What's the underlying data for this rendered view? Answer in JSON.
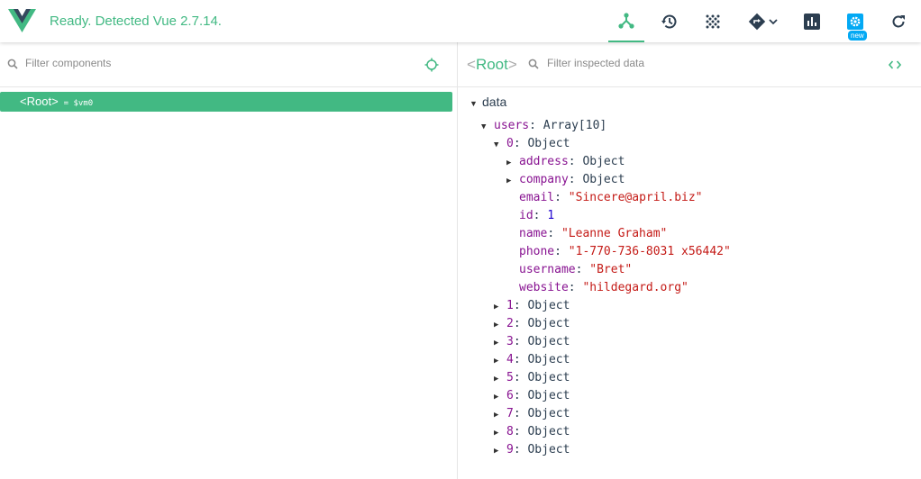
{
  "header": {
    "status": "Ready. Detected Vue 2.7.14.",
    "new_badge": "new",
    "accent": "#42b983"
  },
  "toolbar": [
    "components-icon",
    "history-icon",
    "vuex-dots-icon",
    "routing-icon",
    "chart-icon",
    "settings-icon",
    "refresh-icon"
  ],
  "left": {
    "search_placeholder": "Filter components",
    "root_open": "<",
    "root_name": "Root",
    "root_close": ">",
    "vm_label": "= $vm0"
  },
  "right": {
    "root_open": "<",
    "root_name": "Root",
    "root_close": ">",
    "search_placeholder": "Filter inspected data",
    "section": "data"
  },
  "tree": {
    "users_key": "users",
    "users_type": "Array[10]",
    "item0_key": "0",
    "item0_type": "Object",
    "fields": [
      {
        "key": "address",
        "value": "Object",
        "kind": "obj"
      },
      {
        "key": "company",
        "value": "Object",
        "kind": "obj"
      },
      {
        "key": "email",
        "value": "\"Sincere@april.biz\"",
        "kind": "str"
      },
      {
        "key": "id",
        "value": "1",
        "kind": "num"
      },
      {
        "key": "name",
        "value": "\"Leanne Graham\"",
        "kind": "str"
      },
      {
        "key": "phone",
        "value": "\"1-770-736-8031 x56442\"",
        "kind": "str"
      },
      {
        "key": "username",
        "value": "\"Bret\"",
        "kind": "str"
      },
      {
        "key": "website",
        "value": "\"hildegard.org\"",
        "kind": "str"
      }
    ],
    "collapsed": [
      {
        "key": "1",
        "value": "Object"
      },
      {
        "key": "2",
        "value": "Object"
      },
      {
        "key": "3",
        "value": "Object"
      },
      {
        "key": "4",
        "value": "Object"
      },
      {
        "key": "5",
        "value": "Object"
      },
      {
        "key": "6",
        "value": "Object"
      },
      {
        "key": "7",
        "value": "Object"
      },
      {
        "key": "8",
        "value": "Object"
      },
      {
        "key": "9",
        "value": "Object"
      }
    ]
  }
}
